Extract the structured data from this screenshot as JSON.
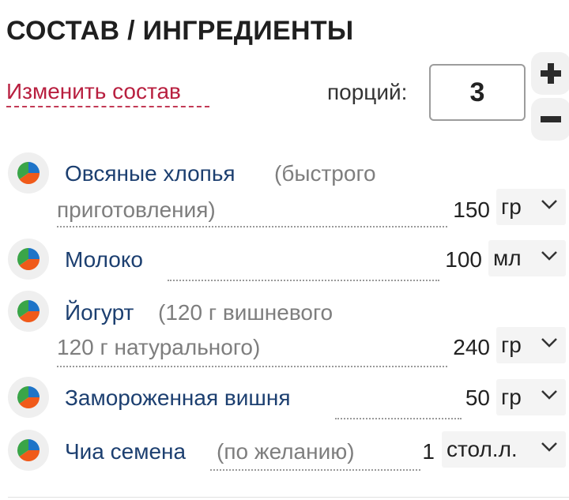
{
  "header": {
    "title": "СОСТАВ / ИНГРЕДИЕНТЫ"
  },
  "controls": {
    "change_label": "Изменить состав",
    "portions_label": "порций:",
    "portions_value": "3"
  },
  "icons": {
    "pie": "pie-chart-icon",
    "plus": "plus-icon",
    "minus": "minus-icon",
    "chevron": "chevron-down-icon"
  },
  "colors": {
    "accent_link": "#b81f3f",
    "ingredient_name": "#1c3f70",
    "pie_blue": "#1e74c8",
    "pie_green": "#3aa548",
    "pie_orange": "#f05a1a"
  },
  "ingredients": [
    {
      "name": "Овсяные хлопья",
      "note_line1": "(быстрого",
      "note_line2": "приготовления)",
      "qty": "150",
      "unit": "гр"
    },
    {
      "name": "Молоко",
      "qty": "100",
      "unit": "мл"
    },
    {
      "name": "Йогурт",
      "note_line1": "(120 г вишневого",
      "note_line2": "120 г натурального)",
      "qty": "240",
      "unit": "гр"
    },
    {
      "name": "Замороженная вишня",
      "qty": "50",
      "unit": "гр"
    },
    {
      "name": "Чиа семена",
      "note_line1": "(по желанию)",
      "qty": "1",
      "unit": "стол.л."
    }
  ]
}
